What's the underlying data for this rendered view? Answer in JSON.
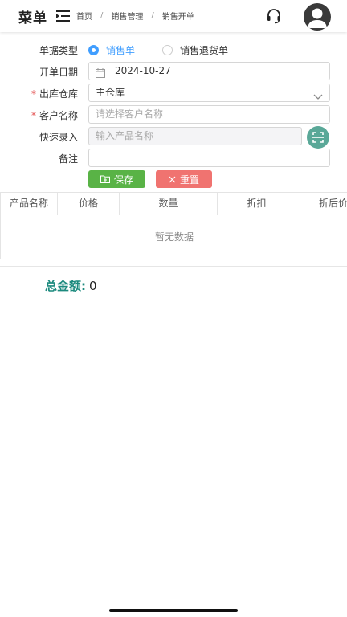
{
  "header": {
    "menu_title": "菜单",
    "breadcrumb": [
      "首页",
      "销售管理",
      "销售开单"
    ],
    "breadcrumb_sep": "/"
  },
  "form": {
    "doc_type": {
      "label": "单据类型",
      "options": [
        {
          "label": "销售单",
          "checked": true
        },
        {
          "label": "销售退货单",
          "checked": false
        }
      ]
    },
    "date": {
      "label": "开单日期",
      "value": "2024-10-27"
    },
    "warehouse": {
      "label": "出库仓库",
      "required": true,
      "value": "主仓库"
    },
    "customer": {
      "label": "客户名称",
      "required": true,
      "placeholder": "请选择客户名称"
    },
    "quick_entry": {
      "label": "快速录入",
      "placeholder": "输入产品名称"
    },
    "remark": {
      "label": "备注",
      "value": ""
    },
    "buttons": {
      "save": "保存",
      "reset": "重置"
    }
  },
  "table": {
    "columns": [
      "产品名称",
      "价格",
      "数量",
      "折扣",
      "折后价"
    ],
    "empty_text": "暂无数据"
  },
  "summary": {
    "total_label": "总金额:",
    "total_value": "0"
  },
  "colors": {
    "primary": "#409eff",
    "save": "#59b346",
    "reset": "#f07370",
    "total": "#1c8a7e",
    "scan": "#5aa898"
  }
}
